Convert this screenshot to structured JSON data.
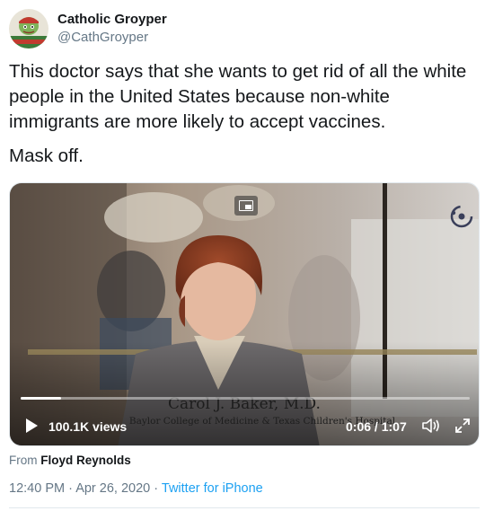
{
  "tweet": {
    "author": {
      "display_name": "Catholic Groyper",
      "handle": "@CathGroyper",
      "avatar_icon": "avatar-image"
    },
    "text": [
      "This doctor says that she wants to get rid of all the white people in the United States because non-white immigrants are more likely to accept vaccines.",
      "Mask off."
    ],
    "video": {
      "caption_name": "Carol J. Baker, M.D.",
      "caption_subtitle": "Baylor College of Medicine & Texas Children's Hospital",
      "views": "100.1K views",
      "elapsed": "0:06",
      "duration": "1:07",
      "progress_fraction": 0.09,
      "icons": [
        "play-icon",
        "volume-icon",
        "expand-icon",
        "picture-in-picture-icon",
        "loading-icon"
      ]
    },
    "attribution": {
      "prefix": "From",
      "name": "Floyd Reynolds"
    },
    "time": "12:40 PM",
    "date": "Apr 26, 2020",
    "separator": "·",
    "source": "Twitter for iPhone"
  },
  "colors": {
    "text": "#14171a",
    "muted": "#657786",
    "link": "#1da1f2",
    "border": "#e1e8ed"
  }
}
